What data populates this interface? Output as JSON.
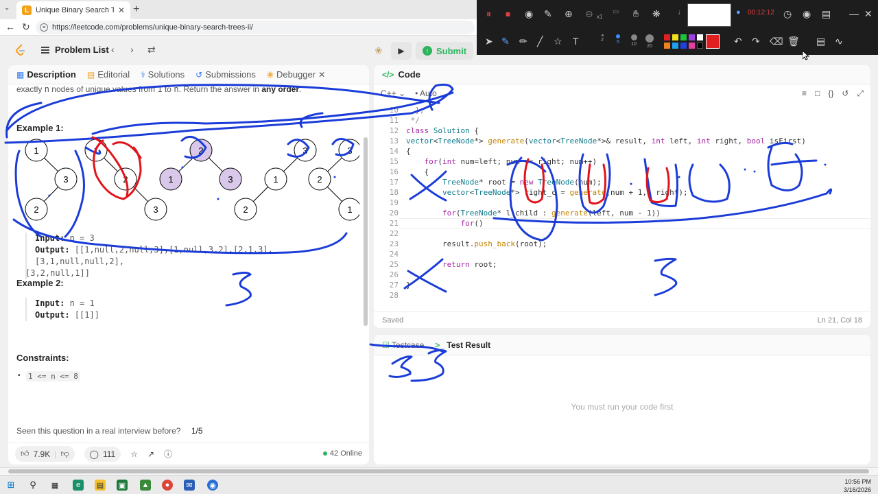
{
  "browser": {
    "tab_title": "Unique Binary Search Trees II - Lee",
    "url": "https://leetcode.com/problems/unique-binary-search-trees-ii/"
  },
  "topbar": {
    "problem_list": "Problem List",
    "submit": "Submit"
  },
  "desc_tabs": [
    {
      "label": "Description"
    },
    {
      "label": "Editorial"
    },
    {
      "label": "Solutions"
    },
    {
      "label": "Submissions"
    },
    {
      "label": "Debugger"
    }
  ],
  "description": {
    "intro_a": "exactly",
    "intro_n": "n",
    "intro_b": "nodes of unique values from",
    "intro_1": "1",
    "intro_to": "to",
    "intro_n2": "n",
    "intro_c": ". Return the answer in",
    "intro_order": "any order",
    "intro_end": ".",
    "example1_title": "Example 1:",
    "example1_input_label": "Input:",
    "example1_input": "n = 3",
    "example1_output_label": "Output:",
    "example1_output_1": "[[1,null,2,null,3],[1,null,3,2],[2,1,3],[3,1,null,null,2],",
    "example1_output_2": "[3,2,null,1]]",
    "example2_title": "Example 2:",
    "example2_input_label": "Input:",
    "example2_input": "n = 1",
    "example2_output_label": "Output:",
    "example2_output": "[[1]]",
    "constraints_title": "Constraints:",
    "constraint": "1 <= n <= 8",
    "seen_question": "Seen this question in a real interview before?",
    "seen_count": "1/5"
  },
  "trees": {
    "t1": [
      "1",
      "3",
      "2"
    ],
    "t2": [
      "1",
      "2",
      "3"
    ],
    "t3": [
      "2",
      "1",
      "3"
    ],
    "t4": [
      "3",
      "1",
      "2"
    ],
    "t5": [
      "3",
      "2",
      "1"
    ]
  },
  "footer": {
    "likes": "7.9K",
    "comments": "111",
    "online": "42 Online"
  },
  "code_panel": {
    "title": "Code",
    "language": "C++",
    "auto": "Auto",
    "saved": "Saved",
    "cursor": "Ln 21, Col 18",
    "line_numbers": [
      "10",
      "11",
      "12",
      "13",
      "14",
      "15",
      "16",
      "17",
      "18",
      "19",
      "20",
      "21",
      "22",
      "23",
      "24",
      "25",
      "26",
      "27",
      "28"
    ]
  },
  "result_panel": {
    "testcase": "Testcase",
    "test_result": "Test Result",
    "message": "You must run your code first"
  },
  "recorder": {
    "timer": "00:12:12",
    "speed": "x1",
    "sizes": [
      "2",
      "5",
      "10",
      "20"
    ]
  },
  "taskbar": {
    "time": "10:56 PM",
    "date": "3/16/2026"
  },
  "colors": {
    "accent_green": "#2db55d",
    "ink_blue": "#1b3cd8",
    "ink_red": "#e0141c",
    "node_purple": "#d9c8ea"
  }
}
